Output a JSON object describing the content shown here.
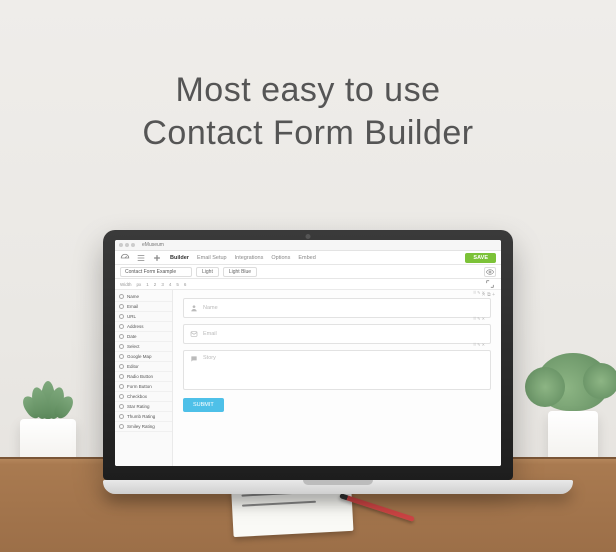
{
  "headline": {
    "line1": "Most easy to use",
    "line2": "Contact Form Builder"
  },
  "browser": {
    "title": "eMuseum"
  },
  "topbar": {
    "tabs": [
      "Builder",
      "Email Setup",
      "Integrations",
      "Options",
      "Embed"
    ],
    "active_tab": "Builder",
    "save_label": "SAVE"
  },
  "secondbar": {
    "form_name": "Contact Form Example",
    "option_a": "Light",
    "option_b": "Light Blue"
  },
  "thirdbar": {
    "width_label": "Width",
    "unit": "px",
    "cols": [
      "1",
      "2",
      "3",
      "4",
      "5",
      "6"
    ]
  },
  "sidebar": {
    "items": [
      "Name",
      "Email",
      "URL",
      "Address",
      "Date",
      "Select",
      "Google Map",
      "Editor",
      "Radio Button",
      "Form Button",
      "Checkbox",
      "Star Rating",
      "Thumb Rating",
      "Smiley Rating"
    ]
  },
  "canvas": {
    "fields": [
      {
        "icon": "user",
        "placeholder": "Name"
      },
      {
        "icon": "mail",
        "placeholder": "Email"
      },
      {
        "icon": "chat",
        "placeholder": "Story"
      }
    ],
    "submit_label": "SUBMIT"
  }
}
